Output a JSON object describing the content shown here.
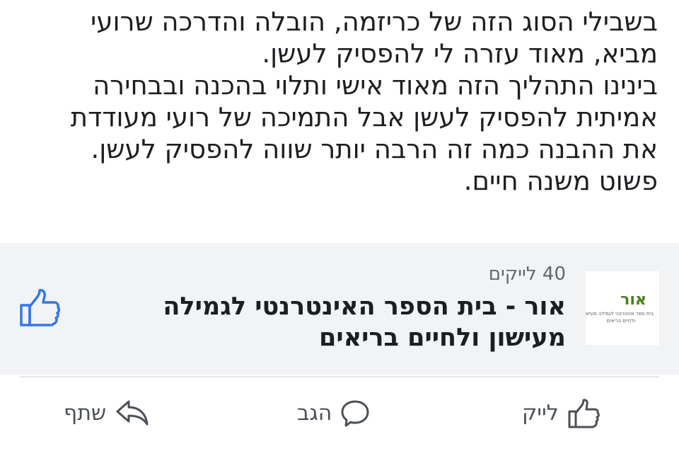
{
  "post": {
    "text_lines": [
      "בשבילי הסוג הזה של כריזמה, הובלה והדרכה שרועי",
      "מביא, מאוד עזרה לי להפסיק לעשן.",
      "בינינו התהליך הזה מאוד אישי ותלוי בהכנה ובבחירה",
      "אמיתית להפסיק לעשן אבל התמיכה של רועי מעודדת",
      "את ההבנה כמה זה הרבה יותר שווה להפסיק לעשן.",
      "פשוט משנה חיים."
    ]
  },
  "link_card": {
    "likes_count": "40 לייקים",
    "page_name_lines": [
      "אור - בית הספר האינטרנטי לגמילה",
      "מעישון ולחיים בריאים"
    ],
    "thumbnail": {
      "logo_word": "אור",
      "logo_lines": [
        "בית ספר אינטרנטי לגמילה מעישון",
        "ולחיים בריאים"
      ]
    },
    "like_icon": "thumbs-up-icon"
  },
  "actions": {
    "like_label": "לייק",
    "comment_label": "הגב",
    "share_label": "שתף",
    "like_icon": "thumbs-up-icon",
    "comment_icon": "speech-bubble-icon",
    "share_icon": "share-arrow-icon"
  },
  "colors": {
    "text": "#1c1e21",
    "muted": "#606770",
    "card_background": "#f2f3f5",
    "brand_blue": "#3578e5",
    "logo_green": "#4a7f1e"
  }
}
